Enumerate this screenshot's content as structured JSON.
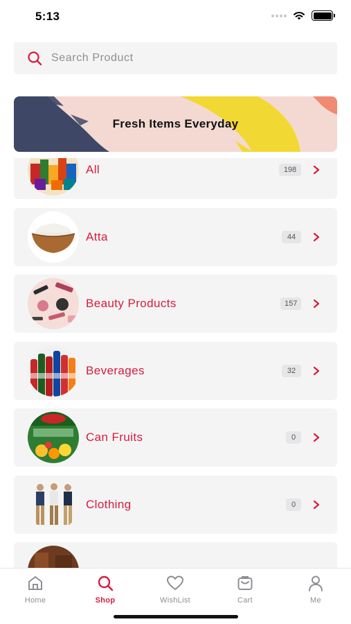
{
  "status_bar": {
    "time": "5:13"
  },
  "search": {
    "placeholder": "Search Product",
    "value": ""
  },
  "banner": {
    "text": "Fresh Items Everyday"
  },
  "categories": [
    {
      "name": "All",
      "count": "198",
      "image": "assorted-products"
    },
    {
      "name": "Atta",
      "count": "44",
      "image": "flour-bowl"
    },
    {
      "name": "Beauty Products",
      "count": "157",
      "image": "cosmetics"
    },
    {
      "name": "Beverages",
      "count": "32",
      "image": "soda-bottles"
    },
    {
      "name": "Can Fruits",
      "count": "0",
      "image": "canned-fruit"
    },
    {
      "name": "Clothing",
      "count": "0",
      "image": "men-fashion"
    }
  ],
  "tabs": [
    {
      "label": "Home",
      "icon": "home-icon",
      "active": false
    },
    {
      "label": "Shop",
      "icon": "search-icon",
      "active": true
    },
    {
      "label": "WishList",
      "icon": "heart-icon",
      "active": false
    },
    {
      "label": "Cart",
      "icon": "cart-icon",
      "active": false
    },
    {
      "label": "Me",
      "icon": "user-icon",
      "active": false
    }
  ],
  "colors": {
    "accent": "#d81b3c",
    "card_bg": "#f4f4f5",
    "tab_inactive": "#8e8e93"
  }
}
